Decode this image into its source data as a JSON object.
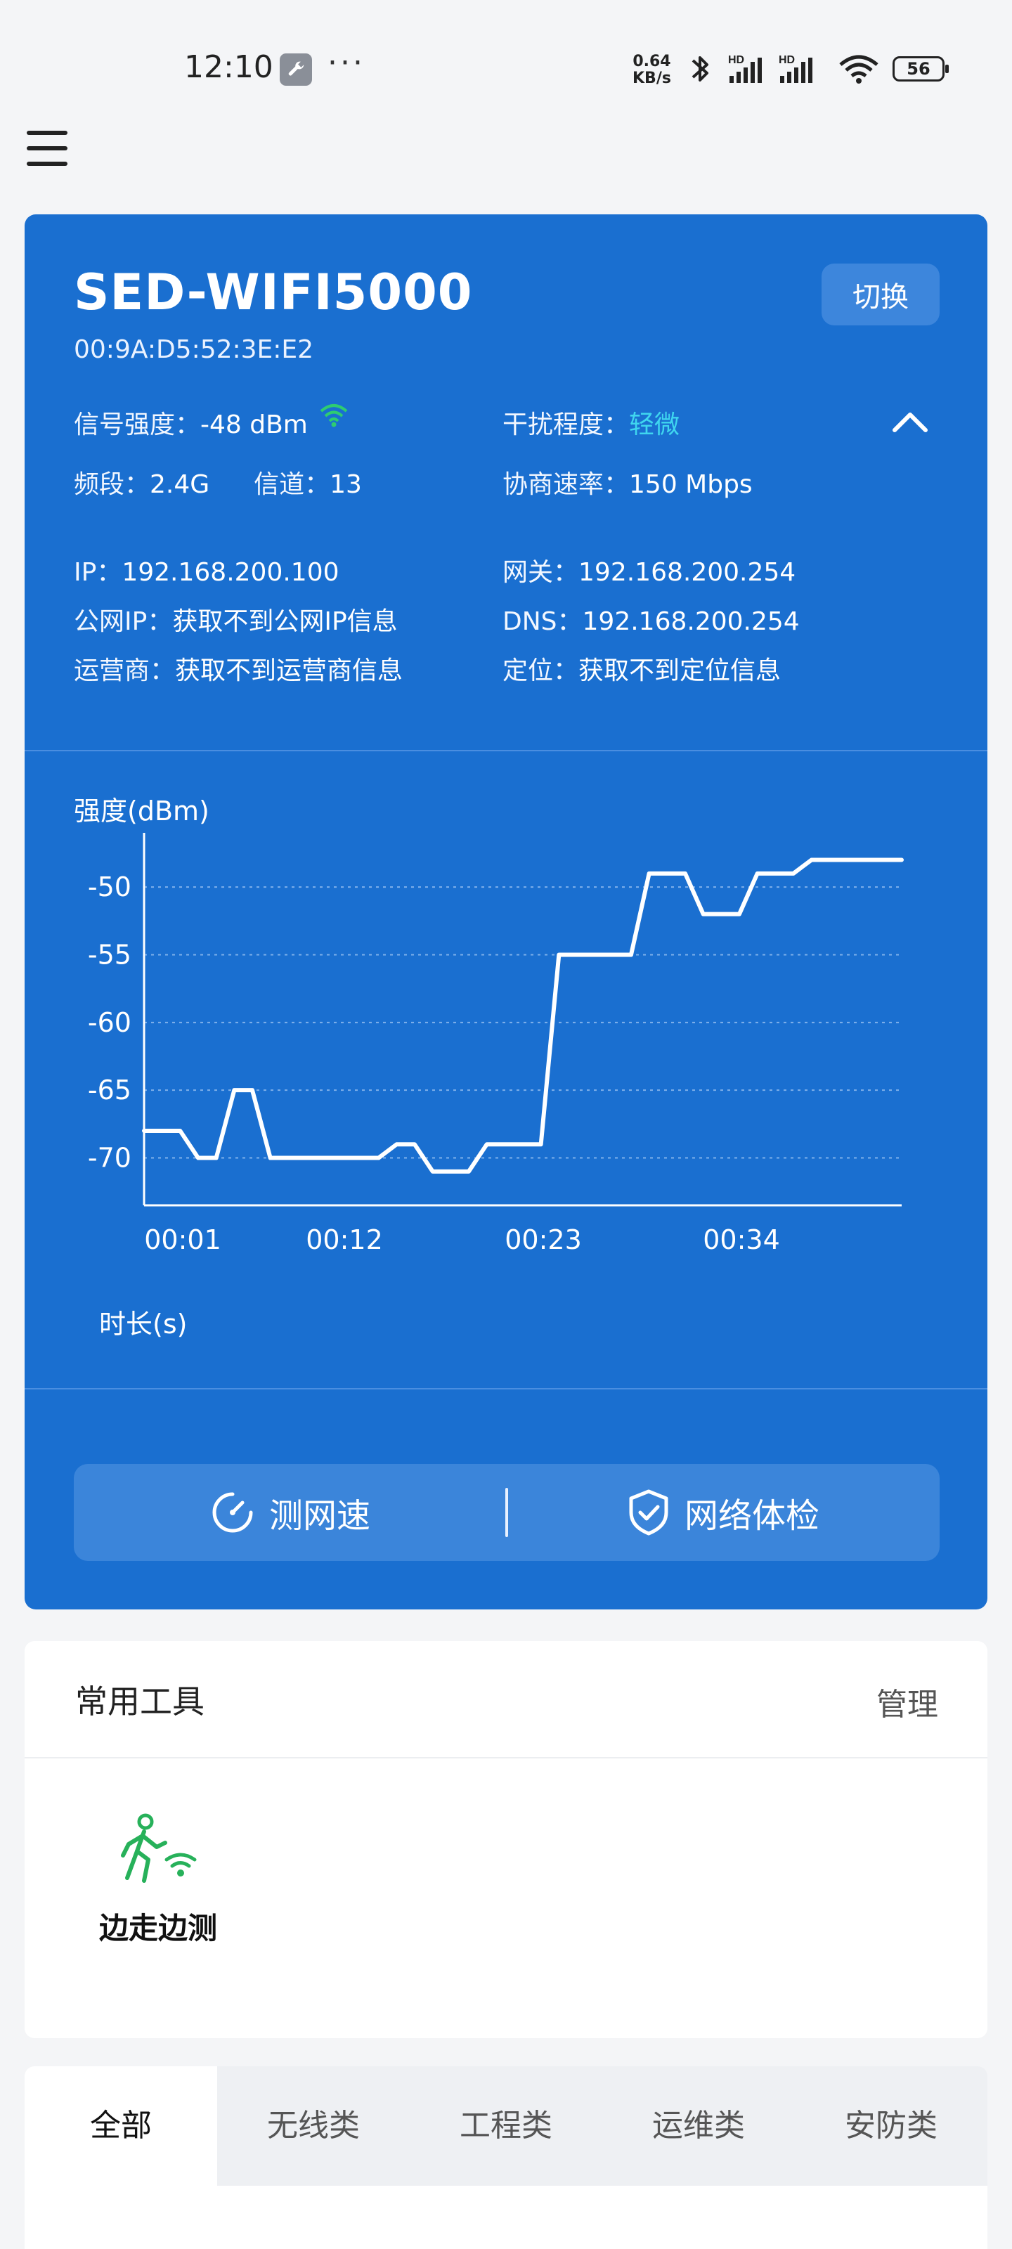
{
  "status_bar": {
    "time": "12:10",
    "net_speed_value": "0.64",
    "net_speed_unit": "KB/s",
    "battery": "56",
    "icons": [
      "wrench-icon",
      "more-dots-icon",
      "bluetooth-icon",
      "hd-signal-icon",
      "hd-signal-icon",
      "wifi-icon"
    ]
  },
  "wifi": {
    "ssid": "SED-WIFI5000",
    "mac": "00:9A:D5:52:3E:E2",
    "switch_label": "切换",
    "signal_label": "信号强度：",
    "signal_value": "-48 dBm",
    "interference_label": "干扰程度：",
    "interference_value": "轻微",
    "band_label": "频段：",
    "band_value": "2.4G",
    "channel_label": "信道：",
    "channel_value": "13",
    "rate_label": "协商速率：",
    "rate_value": "150 Mbps",
    "ip_label": "IP：",
    "ip_value": "192.168.200.100",
    "gateway_label": "网关：",
    "gateway_value": "192.168.200.254",
    "public_ip_label": "公网IP：",
    "public_ip_value": "获取不到公网IP信息",
    "dns_label": "DNS：",
    "dns_value": "192.168.200.254",
    "isp_label": "运营商：",
    "isp_value": "获取不到运营商信息",
    "location_label": "定位：",
    "location_value": "获取不到定位信息"
  },
  "chart_data": {
    "type": "line",
    "ylabel": "强度(dBm)",
    "xlabel": "时长(s)",
    "ylim": [
      -73.5,
      -46
    ],
    "yticks": [
      -50,
      -55,
      -60,
      -65,
      -70
    ],
    "xticks": [
      "00:01",
      "00:12",
      "00:23",
      "00:34"
    ],
    "grid": true,
    "x": [
      0,
      2,
      3,
      4,
      5,
      6,
      7,
      8,
      9,
      10,
      11,
      12,
      13,
      14,
      15,
      16,
      17,
      18,
      19,
      20,
      21,
      22,
      23,
      24,
      25,
      26,
      27,
      28,
      29,
      30,
      31,
      32,
      33,
      34,
      35,
      36,
      37,
      38,
      39,
      40,
      41,
      42
    ],
    "series": [
      {
        "color": "#ffffff",
        "values": [
          -68,
          -68,
          -70,
          -70,
          -65,
          -65,
          -70,
          -70,
          -70,
          -70,
          -70,
          -70,
          -70,
          -69,
          -69,
          -71,
          -71,
          -71,
          -69,
          -69,
          -69,
          -69,
          -55,
          -55,
          -55,
          -55,
          -55,
          -49,
          -49,
          -49,
          -52,
          -52,
          -52,
          -49,
          -49,
          -49,
          -48,
          -48,
          -48,
          -48,
          -48,
          -48
        ]
      }
    ]
  },
  "actions": {
    "speed_test": "测网速",
    "health_check": "网络体检"
  },
  "tools": {
    "title": "常用工具",
    "manage": "管理",
    "items": [
      {
        "label": "边走边测",
        "icon": "walking-wifi-icon"
      }
    ]
  },
  "tabs": [
    {
      "label": "全部",
      "active": true
    },
    {
      "label": "无线类",
      "active": false
    },
    {
      "label": "工程类",
      "active": false
    },
    {
      "label": "运维类",
      "active": false
    },
    {
      "label": "安防类",
      "active": false
    }
  ],
  "colors": {
    "card_blue": "#1a6fd0",
    "accent_cyan": "#3fd6ef",
    "wifi_green": "#2ecc71"
  }
}
